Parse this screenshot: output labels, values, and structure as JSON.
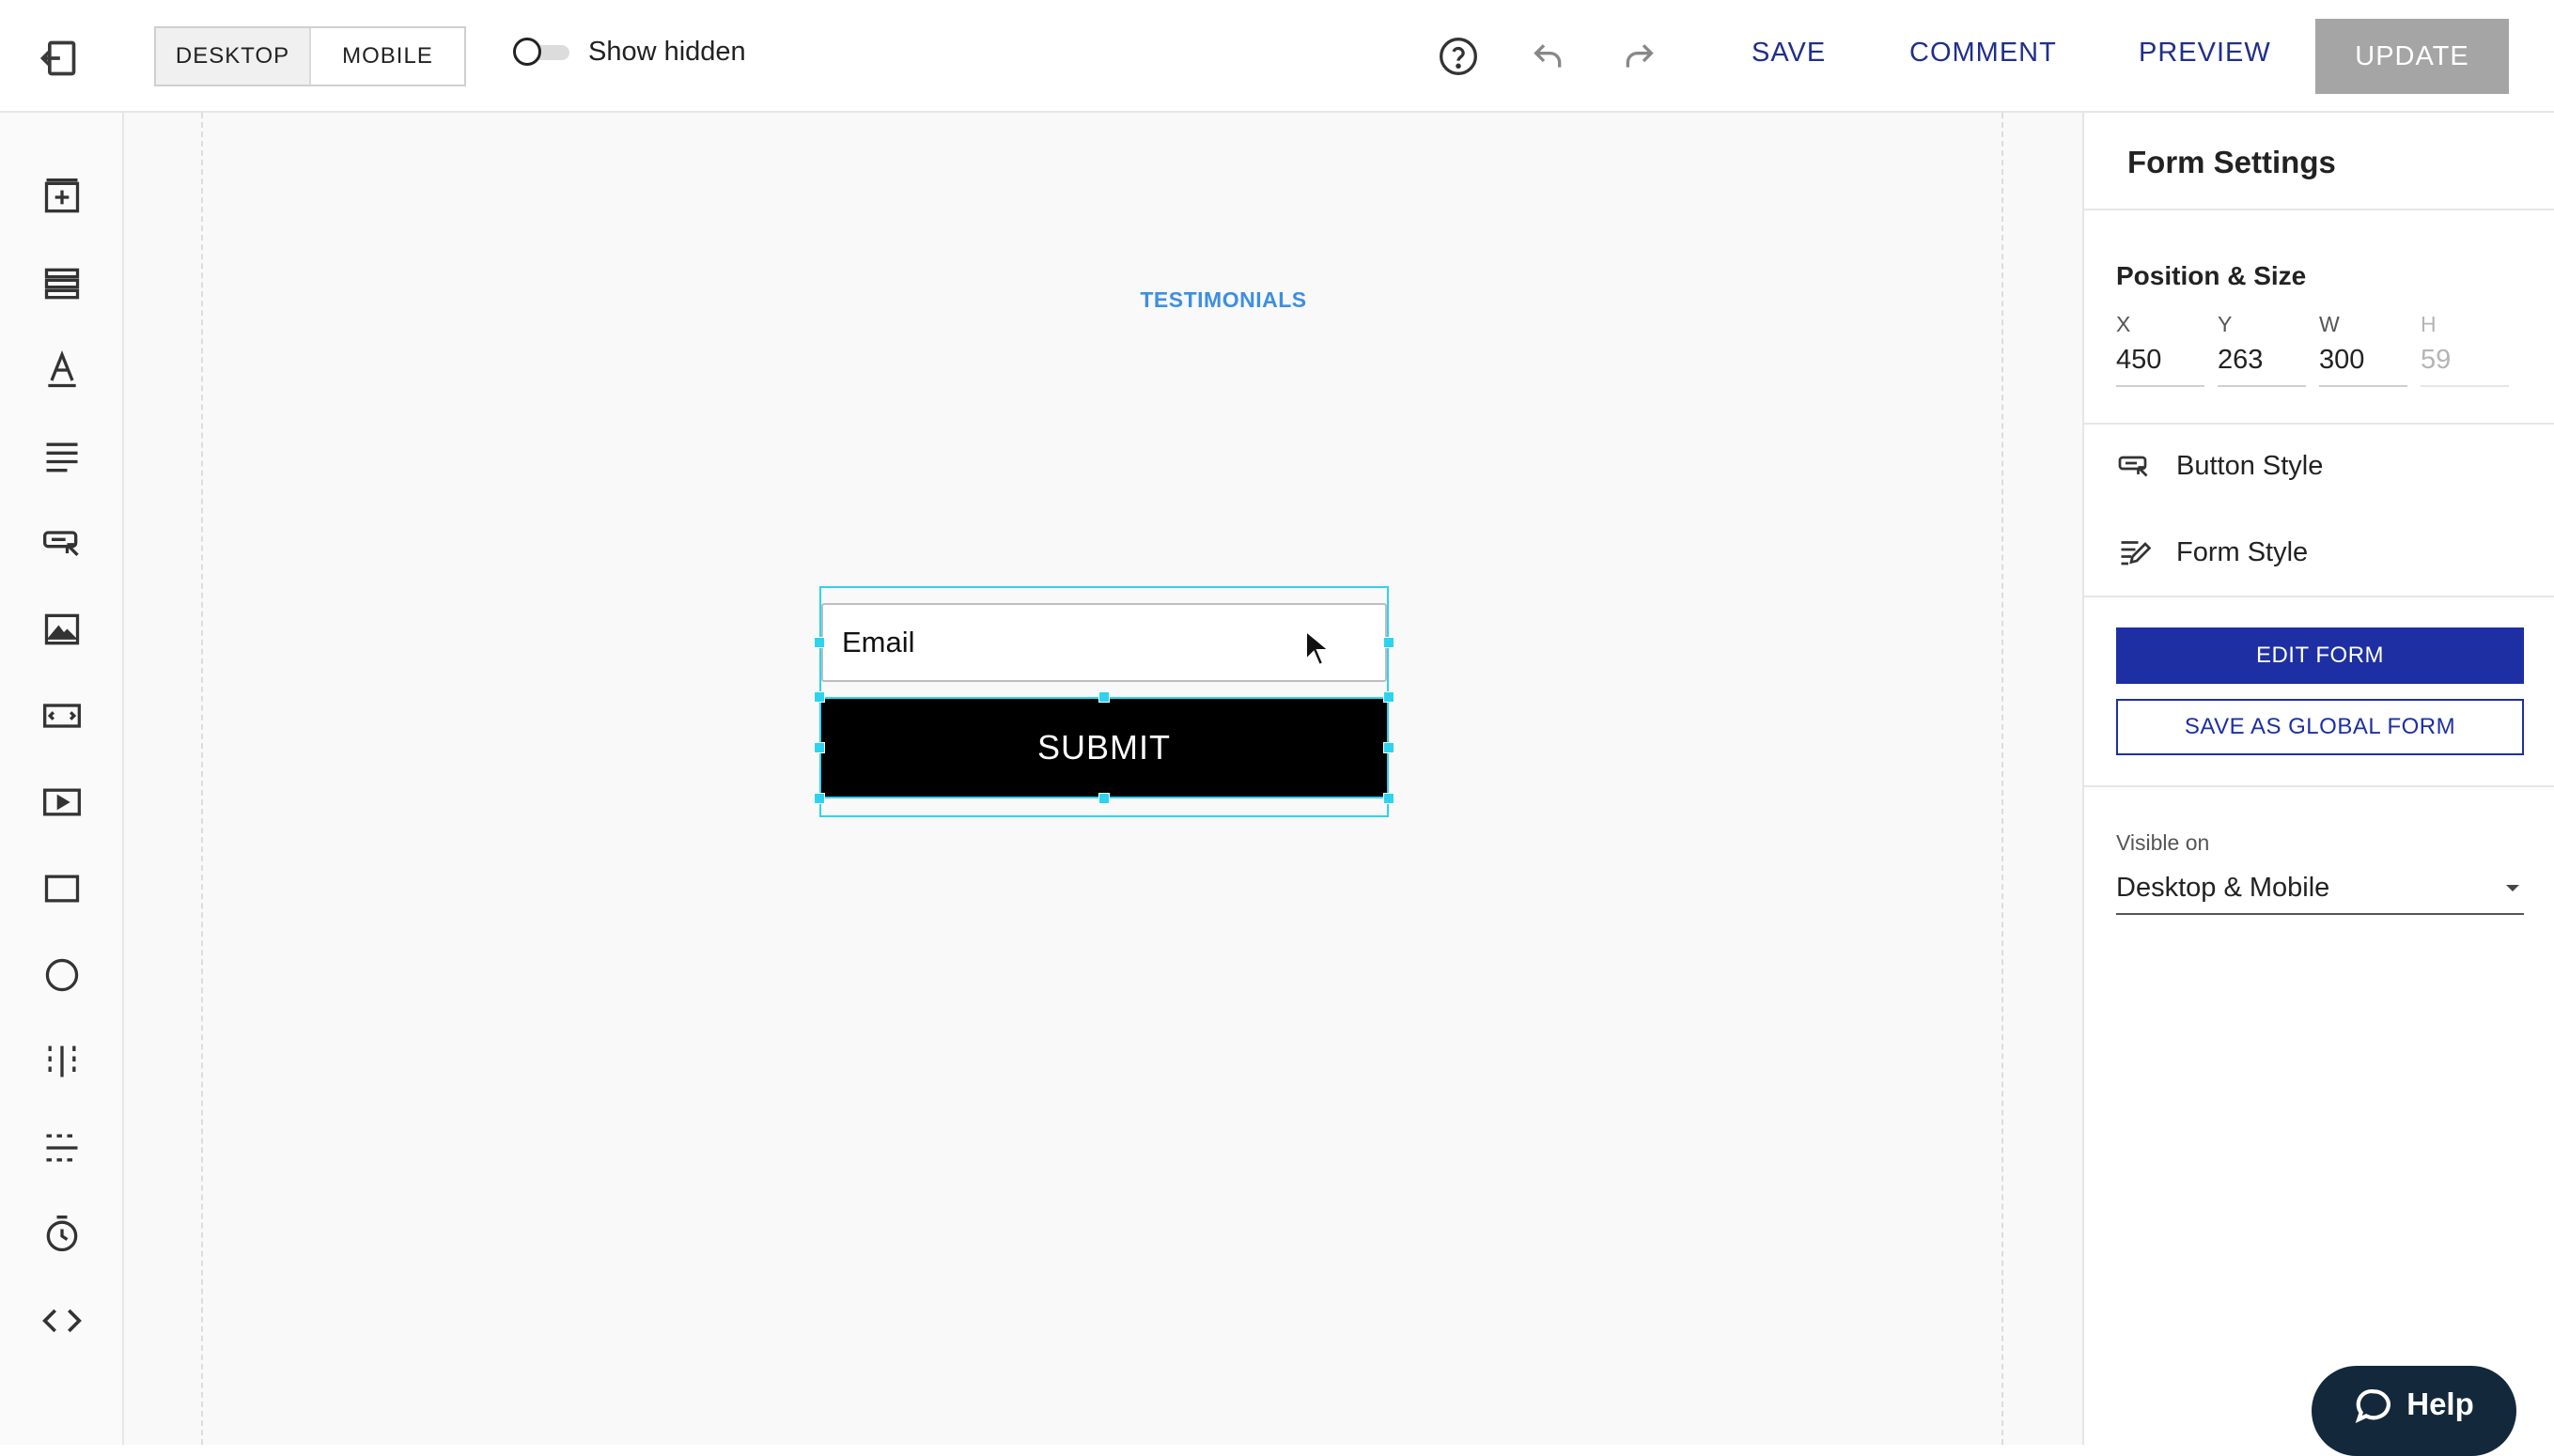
{
  "toolbar": {
    "device_tabs": [
      "DESKTOP",
      "MOBILE"
    ],
    "active_device": "DESKTOP",
    "show_hidden_label": "Show hidden",
    "show_hidden_on": false,
    "save_label": "SAVE",
    "comment_label": "COMMENT",
    "preview_label": "PREVIEW",
    "update_label": "UPDATE",
    "icons": [
      "exit-icon",
      "help-circle-icon",
      "undo-icon",
      "redo-icon"
    ]
  },
  "sidebar": {
    "tools": [
      "add-section-icon",
      "rows-icon",
      "text-icon",
      "paragraph-icon",
      "button-icon",
      "image-icon",
      "embed-icon",
      "video-icon",
      "box-icon",
      "circle-icon",
      "vertical-line-icon",
      "horizontal-line-icon",
      "timer-icon",
      "code-icon"
    ]
  },
  "canvas": {
    "section_label": "TESTIMONIALS",
    "email_placeholder": "Email",
    "submit_label": "SUBMIT"
  },
  "panel": {
    "title": "Form Settings",
    "position_title": "Position & Size",
    "coords": [
      {
        "label": "X",
        "value": "450"
      },
      {
        "label": "Y",
        "value": "263"
      },
      {
        "label": "W",
        "value": "300"
      },
      {
        "label": "H",
        "value": "59"
      }
    ],
    "button_style_label": "Button Style",
    "form_style_label": "Form Style",
    "edit_form_label": "EDIT FORM",
    "save_global_label": "SAVE AS GLOBAL FORM",
    "visible_on_label": "Visible on",
    "visible_on_value": "Desktop & Mobile"
  },
  "help": {
    "label": "Help"
  },
  "colors": {
    "accent": "#1d2fa3",
    "selection": "#2ed3ee",
    "section_link": "#3e8fe0",
    "update_disabled": "#a5a5a5",
    "help_bg": "#13283b"
  }
}
